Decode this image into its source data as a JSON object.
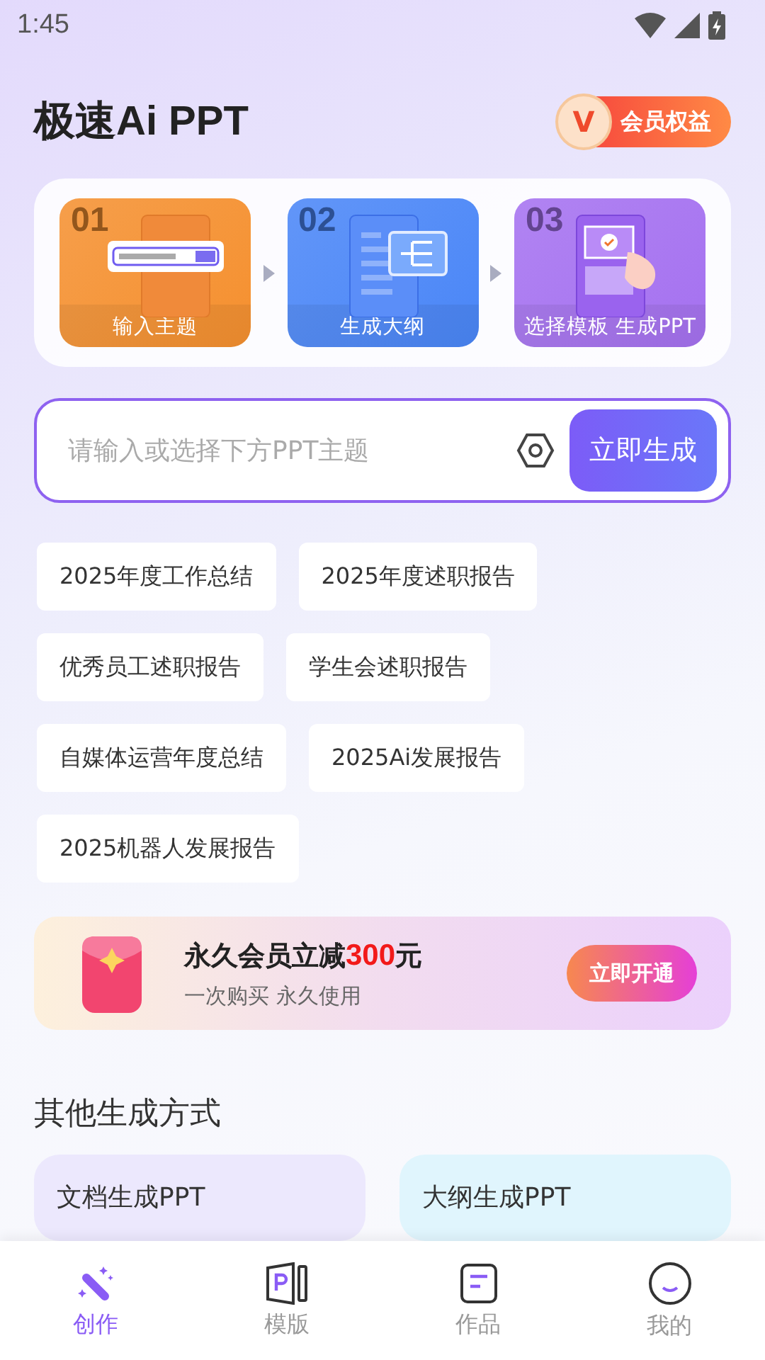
{
  "status_bar": {
    "time": "1:45"
  },
  "header": {
    "title": "极速Ai PPT",
    "vip_button": {
      "badge": "V",
      "label": "会员权益"
    }
  },
  "steps": [
    {
      "kind": "input",
      "number": "01",
      "label": "输入主题",
      "color": "#f5902f"
    },
    {
      "kind": "outline",
      "number": "02",
      "label": "生成大纲",
      "color": "#4a86f7"
    },
    {
      "kind": "template",
      "number": "03",
      "label": "选择模板 生成PPT",
      "color": "#a571f0"
    }
  ],
  "topic_input": {
    "placeholder": "请输入或选择下方PPT主题",
    "button": "立即生成"
  },
  "topics": [
    {
      "label": "2025年度工作总结"
    },
    {
      "label": "2025年度述职报告"
    },
    {
      "label": "优秀员工述职报告"
    },
    {
      "label": "学生会述职报告"
    },
    {
      "label": "自媒体运营年度总结"
    },
    {
      "label": "2025Ai发展报告"
    },
    {
      "label": "2025机器人发展报告"
    }
  ],
  "promo": {
    "title": "永久会员立减",
    "amount": "300",
    "unit": "元",
    "subtitle": "一次购买 永久使用",
    "button": "立即开通"
  },
  "section_title": "其他生成方式",
  "methods": [
    {
      "label": "文档生成PPT",
      "color": "#ece8fd"
    },
    {
      "label": "大纲生成PPT",
      "color": "#e0f5fd"
    }
  ],
  "nav": [
    {
      "label": "创作",
      "selected": true,
      "kind": "create"
    },
    {
      "label": "模版",
      "selected": false,
      "kind": "template"
    },
    {
      "label": "作品",
      "selected": false,
      "kind": "works"
    },
    {
      "label": "我的",
      "selected": false,
      "kind": "me"
    }
  ]
}
